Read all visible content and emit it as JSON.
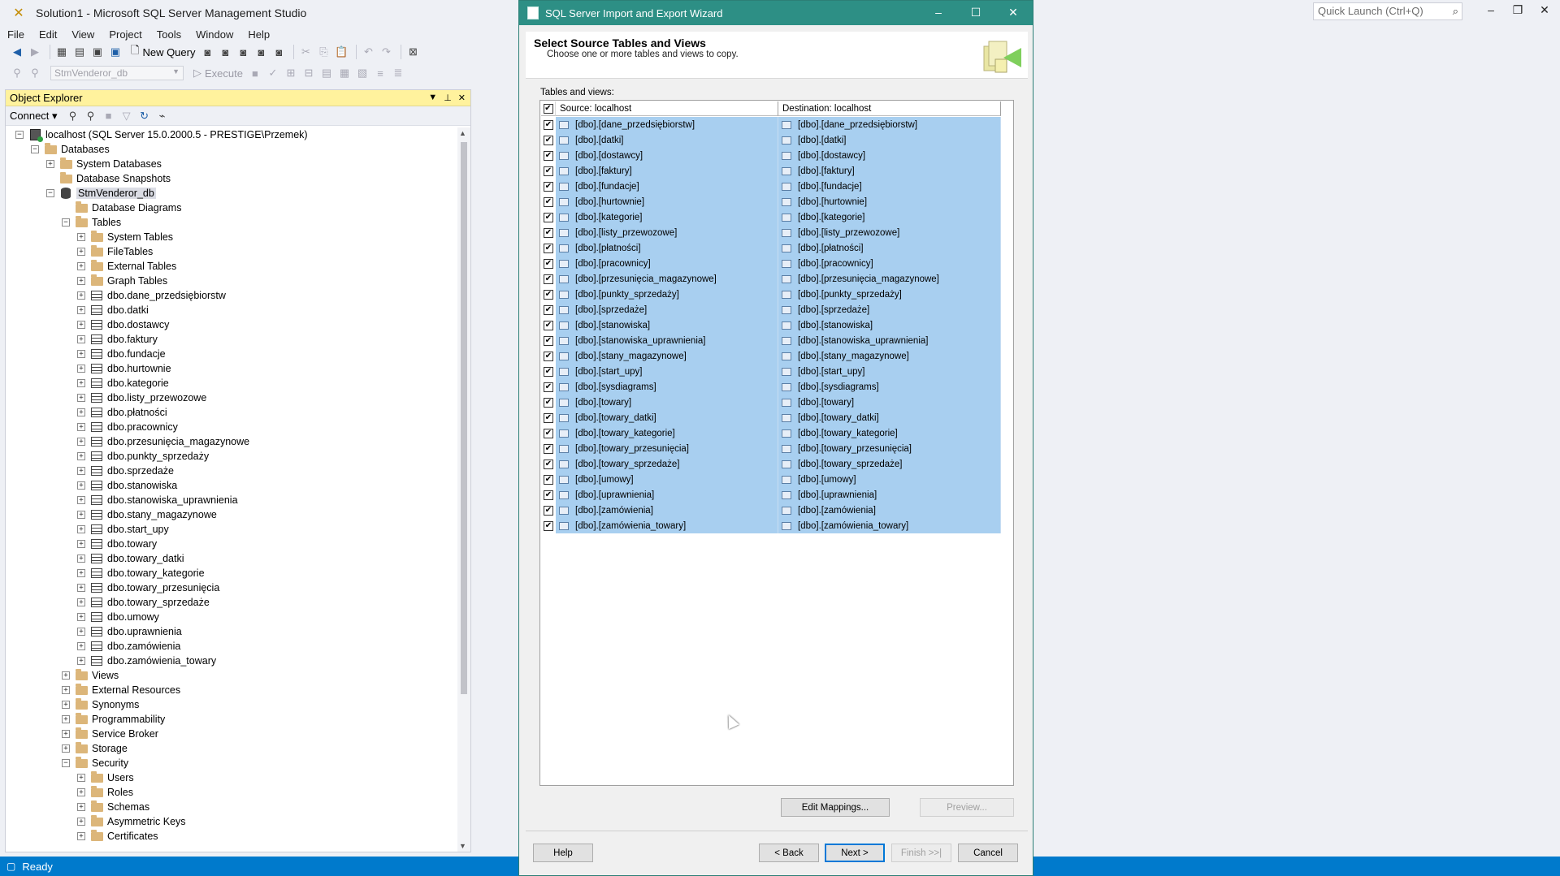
{
  "app": {
    "title": "Solution1 - Microsoft SQL Server Management Studio",
    "quick_launch_placeholder": "Quick Launch (Ctrl+Q)"
  },
  "menu": [
    "File",
    "Edit",
    "View",
    "Project",
    "Tools",
    "Window",
    "Help"
  ],
  "toolbar": {
    "new_query": "New Query",
    "database": "StmVenderor_db",
    "execute": "Execute"
  },
  "object_explorer": {
    "title": "Object Explorer",
    "connect": "Connect",
    "tree": [
      {
        "label": "localhost (SQL Server 15.0.2000.5 - PRESTIGE\\Przemek)",
        "level": 0,
        "exp": "minus",
        "icon": "server"
      },
      {
        "label": "Databases",
        "level": 1,
        "exp": "minus",
        "icon": "folder"
      },
      {
        "label": "System Databases",
        "level": 2,
        "exp": "plus",
        "icon": "folder"
      },
      {
        "label": "Database Snapshots",
        "level": 2,
        "exp": "none",
        "icon": "folder"
      },
      {
        "label": "StmVenderor_db",
        "level": 2,
        "exp": "minus",
        "icon": "database",
        "selected": true
      },
      {
        "label": "Database Diagrams",
        "level": 3,
        "exp": "none",
        "icon": "folder"
      },
      {
        "label": "Tables",
        "level": 3,
        "exp": "minus",
        "icon": "folder"
      },
      {
        "label": "System Tables",
        "level": 4,
        "exp": "plus",
        "icon": "folder"
      },
      {
        "label": "FileTables",
        "level": 4,
        "exp": "plus",
        "icon": "folder"
      },
      {
        "label": "External Tables",
        "level": 4,
        "exp": "plus",
        "icon": "folder"
      },
      {
        "label": "Graph Tables",
        "level": 4,
        "exp": "plus",
        "icon": "folder"
      },
      {
        "label": "dbo.dane_przedsiębiorstw",
        "level": 4,
        "exp": "plus",
        "icon": "table"
      },
      {
        "label": "dbo.datki",
        "level": 4,
        "exp": "plus",
        "icon": "table"
      },
      {
        "label": "dbo.dostawcy",
        "level": 4,
        "exp": "plus",
        "icon": "table"
      },
      {
        "label": "dbo.faktury",
        "level": 4,
        "exp": "plus",
        "icon": "table"
      },
      {
        "label": "dbo.fundacje",
        "level": 4,
        "exp": "plus",
        "icon": "table"
      },
      {
        "label": "dbo.hurtownie",
        "level": 4,
        "exp": "plus",
        "icon": "table"
      },
      {
        "label": "dbo.kategorie",
        "level": 4,
        "exp": "plus",
        "icon": "table"
      },
      {
        "label": "dbo.listy_przewozowe",
        "level": 4,
        "exp": "plus",
        "icon": "table"
      },
      {
        "label": "dbo.płatności",
        "level": 4,
        "exp": "plus",
        "icon": "table"
      },
      {
        "label": "dbo.pracownicy",
        "level": 4,
        "exp": "plus",
        "icon": "table"
      },
      {
        "label": "dbo.przesunięcia_magazynowe",
        "level": 4,
        "exp": "plus",
        "icon": "table"
      },
      {
        "label": "dbo.punkty_sprzedaży",
        "level": 4,
        "exp": "plus",
        "icon": "table"
      },
      {
        "label": "dbo.sprzedaże",
        "level": 4,
        "exp": "plus",
        "icon": "table"
      },
      {
        "label": "dbo.stanowiska",
        "level": 4,
        "exp": "plus",
        "icon": "table"
      },
      {
        "label": "dbo.stanowiska_uprawnienia",
        "level": 4,
        "exp": "plus",
        "icon": "table"
      },
      {
        "label": "dbo.stany_magazynowe",
        "level": 4,
        "exp": "plus",
        "icon": "table"
      },
      {
        "label": "dbo.start_upy",
        "level": 4,
        "exp": "plus",
        "icon": "table"
      },
      {
        "label": "dbo.towary",
        "level": 4,
        "exp": "plus",
        "icon": "table"
      },
      {
        "label": "dbo.towary_datki",
        "level": 4,
        "exp": "plus",
        "icon": "table"
      },
      {
        "label": "dbo.towary_kategorie",
        "level": 4,
        "exp": "plus",
        "icon": "table"
      },
      {
        "label": "dbo.towary_przesunięcia",
        "level": 4,
        "exp": "plus",
        "icon": "table"
      },
      {
        "label": "dbo.towary_sprzedaże",
        "level": 4,
        "exp": "plus",
        "icon": "table"
      },
      {
        "label": "dbo.umowy",
        "level": 4,
        "exp": "plus",
        "icon": "table"
      },
      {
        "label": "dbo.uprawnienia",
        "level": 4,
        "exp": "plus",
        "icon": "table"
      },
      {
        "label": "dbo.zamówienia",
        "level": 4,
        "exp": "plus",
        "icon": "table"
      },
      {
        "label": "dbo.zamówienia_towary",
        "level": 4,
        "exp": "plus",
        "icon": "table"
      },
      {
        "label": "Views",
        "level": 3,
        "exp": "plus",
        "icon": "folder"
      },
      {
        "label": "External Resources",
        "level": 3,
        "exp": "plus",
        "icon": "folder"
      },
      {
        "label": "Synonyms",
        "level": 3,
        "exp": "plus",
        "icon": "folder"
      },
      {
        "label": "Programmability",
        "level": 3,
        "exp": "plus",
        "icon": "folder"
      },
      {
        "label": "Service Broker",
        "level": 3,
        "exp": "plus",
        "icon": "folder"
      },
      {
        "label": "Storage",
        "level": 3,
        "exp": "plus",
        "icon": "folder"
      },
      {
        "label": "Security",
        "level": 3,
        "exp": "minus",
        "icon": "folder"
      },
      {
        "label": "Users",
        "level": 4,
        "exp": "plus",
        "icon": "folder"
      },
      {
        "label": "Roles",
        "level": 4,
        "exp": "plus",
        "icon": "folder"
      },
      {
        "label": "Schemas",
        "level": 4,
        "exp": "plus",
        "icon": "folder"
      },
      {
        "label": "Asymmetric Keys",
        "level": 4,
        "exp": "plus",
        "icon": "folder"
      },
      {
        "label": "Certificates",
        "level": 4,
        "exp": "plus",
        "icon": "folder"
      }
    ]
  },
  "status": {
    "text": "Ready"
  },
  "wizard": {
    "title": "SQL Server Import and Export Wizard",
    "heading": "Select Source Tables and Views",
    "subheading": "Choose one or more tables and views to copy.",
    "tables_label": "Tables and views:",
    "col_source": "Source: localhost",
    "col_destination": "Destination: localhost",
    "rows": [
      {
        "source": "[dbo].[dane_przedsiębiorstw]",
        "destination": "[dbo].[dane_przedsiębiorstw]",
        "checked": true
      },
      {
        "source": "[dbo].[datki]",
        "destination": "[dbo].[datki]",
        "checked": true
      },
      {
        "source": "[dbo].[dostawcy]",
        "destination": "[dbo].[dostawcy]",
        "checked": true
      },
      {
        "source": "[dbo].[faktury]",
        "destination": "[dbo].[faktury]",
        "checked": true
      },
      {
        "source": "[dbo].[fundacje]",
        "destination": "[dbo].[fundacje]",
        "checked": true
      },
      {
        "source": "[dbo].[hurtownie]",
        "destination": "[dbo].[hurtownie]",
        "checked": true
      },
      {
        "source": "[dbo].[kategorie]",
        "destination": "[dbo].[kategorie]",
        "checked": true
      },
      {
        "source": "[dbo].[listy_przewozowe]",
        "destination": "[dbo].[listy_przewozowe]",
        "checked": true
      },
      {
        "source": "[dbo].[płatności]",
        "destination": "[dbo].[płatności]",
        "checked": true
      },
      {
        "source": "[dbo].[pracownicy]",
        "destination": "[dbo].[pracownicy]",
        "checked": true
      },
      {
        "source": "[dbo].[przesunięcia_magazynowe]",
        "destination": "[dbo].[przesunięcia_magazynowe]",
        "checked": true
      },
      {
        "source": "[dbo].[punkty_sprzedaży]",
        "destination": "[dbo].[punkty_sprzedaży]",
        "checked": true
      },
      {
        "source": "[dbo].[sprzedaże]",
        "destination": "[dbo].[sprzedaże]",
        "checked": true
      },
      {
        "source": "[dbo].[stanowiska]",
        "destination": "[dbo].[stanowiska]",
        "checked": true
      },
      {
        "source": "[dbo].[stanowiska_uprawnienia]",
        "destination": "[dbo].[stanowiska_uprawnienia]",
        "checked": true
      },
      {
        "source": "[dbo].[stany_magazynowe]",
        "destination": "[dbo].[stany_magazynowe]",
        "checked": true
      },
      {
        "source": "[dbo].[start_upy]",
        "destination": "[dbo].[start_upy]",
        "checked": true
      },
      {
        "source": "[dbo].[sysdiagrams]",
        "destination": "[dbo].[sysdiagrams]",
        "checked": true
      },
      {
        "source": "[dbo].[towary]",
        "destination": "[dbo].[towary]",
        "checked": true
      },
      {
        "source": "[dbo].[towary_datki]",
        "destination": "[dbo].[towary_datki]",
        "checked": true
      },
      {
        "source": "[dbo].[towary_kategorie]",
        "destination": "[dbo].[towary_kategorie]",
        "checked": true
      },
      {
        "source": "[dbo].[towary_przesunięcia]",
        "destination": "[dbo].[towary_przesunięcia]",
        "checked": true
      },
      {
        "source": "[dbo].[towary_sprzedaże]",
        "destination": "[dbo].[towary_sprzedaże]",
        "checked": true
      },
      {
        "source": "[dbo].[umowy]",
        "destination": "[dbo].[umowy]",
        "checked": true
      },
      {
        "source": "[dbo].[uprawnienia]",
        "destination": "[dbo].[uprawnienia]",
        "checked": true
      },
      {
        "source": "[dbo].[zamówienia]",
        "destination": "[dbo].[zamówienia]",
        "checked": true
      },
      {
        "source": "[dbo].[zamówienia_towary]",
        "destination": "[dbo].[zamówienia_towary]",
        "checked": true
      }
    ],
    "buttons": {
      "edit_mappings": "Edit Mappings...",
      "preview": "Preview...",
      "help": "Help",
      "back": "< Back",
      "next": "Next >",
      "finish": "Finish >>|",
      "cancel": "Cancel"
    }
  },
  "colors": {
    "wizard_titlebar": "#2d8f85",
    "status_bar": "#007acc",
    "oe_header": "#fff29d",
    "row_selected": "#a8cff0"
  }
}
